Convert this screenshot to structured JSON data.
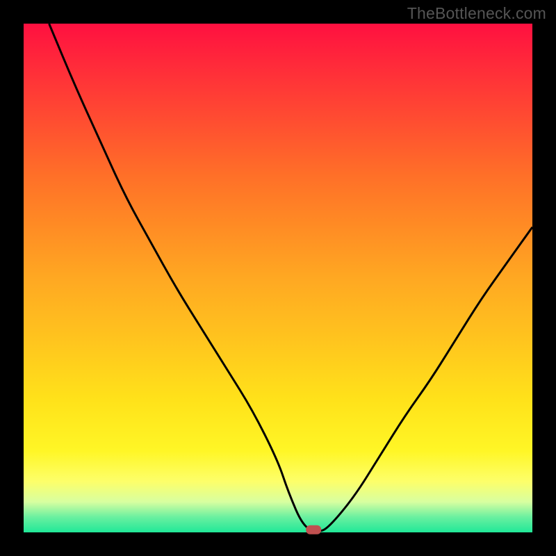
{
  "watermark": "TheBottleneck.com",
  "chart_data": {
    "type": "line",
    "title": "",
    "xlabel": "",
    "ylabel": "",
    "xlim": [
      0,
      100
    ],
    "ylim": [
      0,
      100
    ],
    "series": [
      {
        "name": "curve",
        "x": [
          5,
          10,
          15,
          20,
          25,
          30,
          35,
          40,
          45,
          50,
          52,
          55,
          58,
          60,
          65,
          70,
          75,
          80,
          85,
          90,
          95,
          100
        ],
        "values": [
          100,
          88,
          77,
          66,
          57,
          48,
          40,
          32,
          24,
          14,
          8,
          1,
          0,
          1,
          7,
          15,
          23,
          30,
          38,
          46,
          53,
          60
        ]
      }
    ],
    "marker": {
      "x": 57,
      "y": 0.5
    },
    "gradient_colors": {
      "top": "#ff1040",
      "mid_upper": "#ff8c24",
      "mid": "#ffe21a",
      "mid_lower": "#fdff6a",
      "bottom": "#20e898"
    }
  }
}
